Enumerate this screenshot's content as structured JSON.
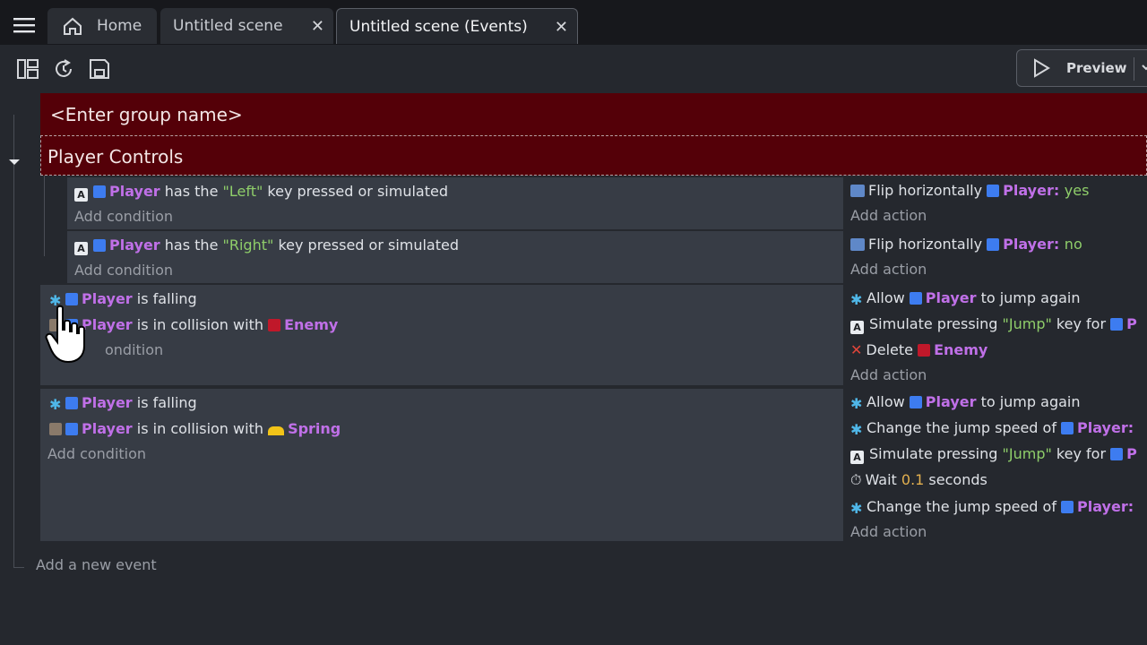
{
  "tabs": {
    "home_label": "Home",
    "scene_label": "Untitled scene",
    "events_label": "Untitled scene (Events)",
    "close_glyph": "✕"
  },
  "toolbar": {
    "preview_label": "Preview"
  },
  "groups": {
    "empty_group": "<Enter group name>",
    "player_controls": "Player Controls"
  },
  "events": [
    {
      "conditions": [
        {
          "icon": "keyboard-icon",
          "object": "Player",
          "pre": "has the ",
          "str": "\"Left\"",
          "post": " key pressed or simulated"
        }
      ],
      "add_condition": "Add condition",
      "actions": [
        {
          "icon": "flip-icon",
          "verb": "Flip horizontally ",
          "object": "Player",
          "sep": ": ",
          "value": "yes"
        }
      ],
      "add_action": "Add action"
    },
    {
      "conditions": [
        {
          "icon": "keyboard-icon",
          "object": "Player",
          "pre": "has the ",
          "str": "\"Right\"",
          "post": " key pressed or simulated"
        }
      ],
      "add_condition": "Add condition",
      "actions": [
        {
          "icon": "flip-icon",
          "verb": "Flip horizontally ",
          "object": "Player",
          "sep": ": ",
          "value": "no"
        }
      ],
      "add_action": "Add action"
    },
    {
      "conditions": [
        {
          "icon": "platformer-icon",
          "object": "Player",
          "post": " is falling"
        },
        {
          "icon": "collision-icon",
          "object": "Player",
          "post": " is in collision with ",
          "object2": "Enemy"
        }
      ],
      "add_condition": "ondition",
      "actions": [
        {
          "icon": "platformer-icon",
          "verb": "Allow ",
          "object": "Player",
          "post": " to jump again"
        },
        {
          "icon": "keyboard-icon",
          "verb": "Simulate pressing ",
          "str": "\"Jump\"",
          "post": " key for ",
          "object": "P"
        },
        {
          "icon": "delete-icon",
          "verb": "Delete ",
          "object": "Enemy"
        }
      ],
      "add_action": "Add action"
    },
    {
      "conditions": [
        {
          "icon": "platformer-icon",
          "object": "Player",
          "post": " is falling"
        },
        {
          "icon": "collision-icon",
          "object": "Player",
          "post": " is in collision with ",
          "object2": "Spring"
        }
      ],
      "add_condition": "Add condition",
      "actions": [
        {
          "icon": "platformer-icon",
          "verb": "Allow ",
          "object": "Player",
          "post": " to jump again"
        },
        {
          "icon": "platformer-icon",
          "verb": "Change the jump speed of ",
          "object": "Player:"
        },
        {
          "icon": "keyboard-icon",
          "verb": "Simulate pressing ",
          "str": "\"Jump\"",
          "post": " key for ",
          "object": "P"
        },
        {
          "icon": "timer-icon",
          "verb": "Wait ",
          "num": "0.1",
          "post": " seconds"
        },
        {
          "icon": "platformer-icon",
          "verb": "Change the jump speed of ",
          "object": "Player:"
        }
      ],
      "add_action": "Add action"
    }
  ],
  "add_new_event": "Add a new event",
  "colors": {
    "group_bg": "#540008",
    "object_name": "#c070e8",
    "string_value": "#8fce6a",
    "number_value": "#e3b04f"
  }
}
